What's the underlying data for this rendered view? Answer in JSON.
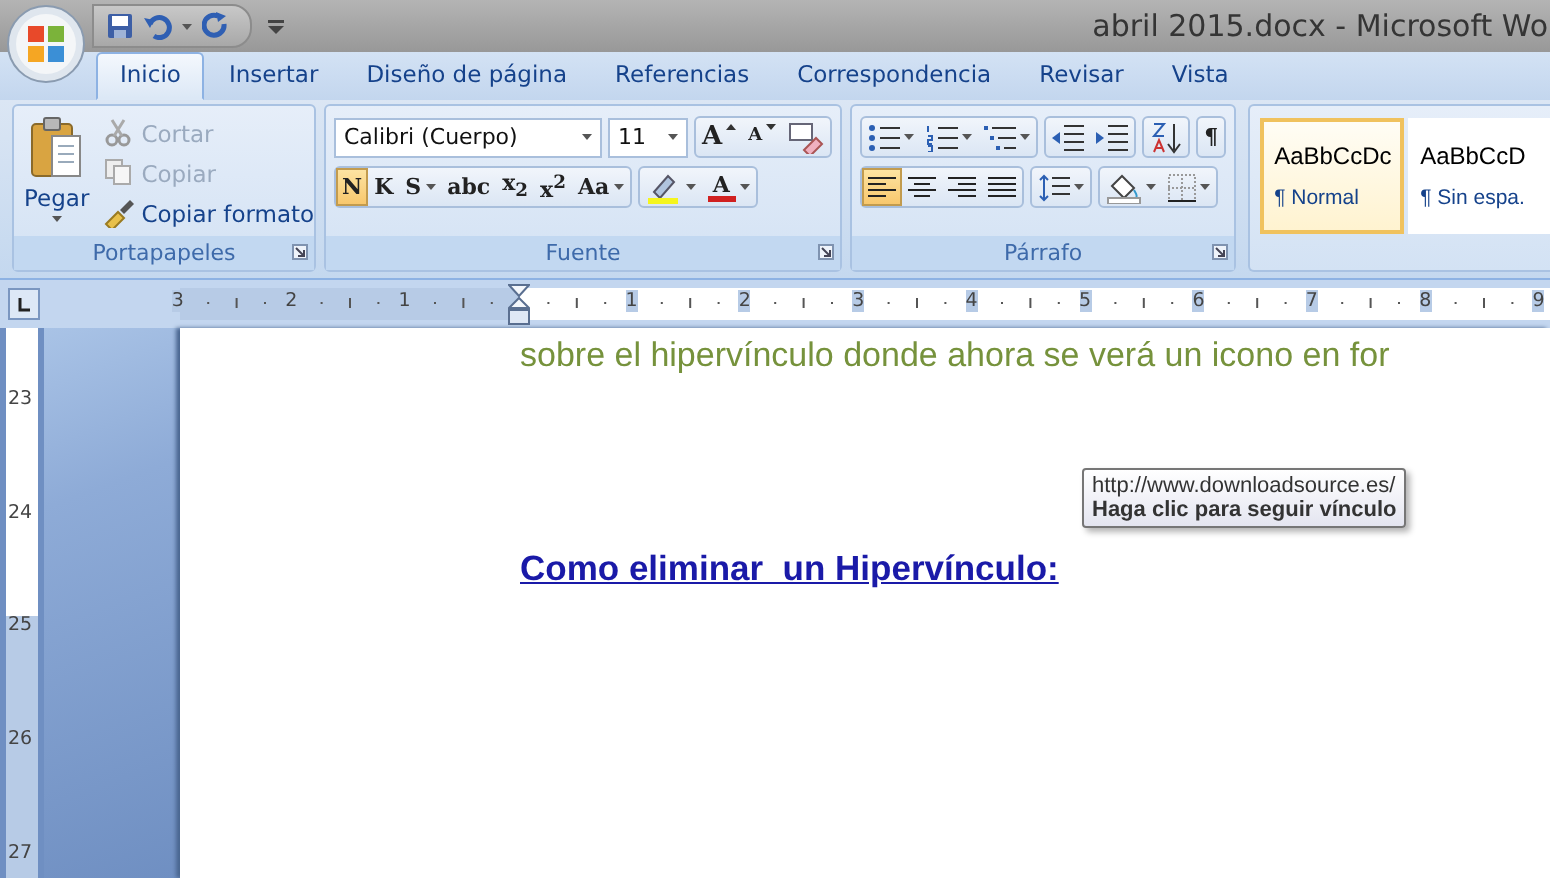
{
  "window": {
    "title": "abril 2015.docx - Microsoft Wo"
  },
  "tabs": [
    {
      "label": "Inicio",
      "selected": true
    },
    {
      "label": "Insertar",
      "selected": false
    },
    {
      "label": "Diseño de página",
      "selected": false
    },
    {
      "label": "Referencias",
      "selected": false
    },
    {
      "label": "Correspondencia",
      "selected": false
    },
    {
      "label": "Revisar",
      "selected": false
    },
    {
      "label": "Vista",
      "selected": false
    }
  ],
  "clipboard": {
    "label": "Portapapeles",
    "paste": "Pegar",
    "items": [
      {
        "kind": "cut",
        "label": "Cortar",
        "disabled": true
      },
      {
        "kind": "copy",
        "label": "Copiar",
        "disabled": true
      },
      {
        "kind": "brush",
        "label": "Copiar formato",
        "disabled": false
      }
    ]
  },
  "font": {
    "label": "Fuente",
    "font_name": "Calibri (Cuerpo)",
    "font_size": "11",
    "row1": [
      {
        "kind": "grow",
        "label": "A"
      },
      {
        "kind": "shrink",
        "label": "A"
      },
      {
        "kind": "eraser"
      }
    ],
    "row2": [
      {
        "kind": "glyph",
        "label": "N",
        "selected": true,
        "dropdown": false
      },
      {
        "kind": "glyph",
        "label": "K",
        "selected": false,
        "dropdown": false
      },
      {
        "kind": "glyph",
        "label": "S",
        "selected": false,
        "dropdown": true
      },
      {
        "kind": "glyph",
        "label": "abc",
        "selected": false,
        "dropdown": false
      },
      {
        "kind": "glyph",
        "label": "x$_{2}$",
        "selected": false,
        "dropdown": false
      },
      {
        "kind": "glyph",
        "label": "x$^{2}$",
        "selected": false,
        "dropdown": false
      },
      {
        "kind": "glyph",
        "label": "Aa",
        "selected": false,
        "dropdown": true
      },
      {
        "kind": "highlight",
        "selected": false,
        "dropdown": true
      },
      {
        "kind": "fontcolor",
        "label": "A",
        "selected": false,
        "dropdown": true
      }
    ]
  },
  "paragraph": {
    "label": "Párrafo",
    "row1": [
      {
        "kind": "bullets",
        "selected": false,
        "dropdown": true
      },
      {
        "kind": "numbers",
        "selected": false,
        "dropdown": true
      },
      {
        "kind": "multilevel",
        "selected": false,
        "dropdown": true
      },
      {
        "kind": "outdent",
        "selected": false,
        "dropdown": false
      },
      {
        "kind": "indent",
        "selected": false,
        "dropdown": false
      },
      {
        "kind": "sort",
        "selected": false,
        "dropdown": false
      },
      {
        "kind": "glyph",
        "label": "¶",
        "selected": false,
        "dropdown": false
      }
    ],
    "row2": [
      {
        "kind": "align-left",
        "selected": true,
        "dropdown": false
      },
      {
        "kind": "align-center",
        "selected": false,
        "dropdown": false
      },
      {
        "kind": "align-right",
        "selected": false,
        "dropdown": false
      },
      {
        "kind": "justify",
        "selected": false,
        "dropdown": false
      },
      {
        "kind": "spacing",
        "selected": false,
        "dropdown": true
      },
      {
        "kind": "shading",
        "selected": false,
        "dropdown": true
      },
      {
        "kind": "borders",
        "selected": false,
        "dropdown": true
      }
    ]
  },
  "styles": [
    {
      "preview": "AaBbCcDc",
      "label": "¶ Normal",
      "selected": true
    },
    {
      "preview": "AaBbCcD",
      "label": "¶ Sin espa.",
      "selected": false
    }
  ],
  "ruler": {
    "numbers": [
      "3",
      "2",
      "1",
      "1",
      "2",
      "3",
      "4",
      "5",
      "6",
      "7",
      "8",
      "9"
    ],
    "vertical_numbers": [
      "23",
      "24",
      "25",
      "26",
      "27"
    ]
  },
  "document": {
    "paragraph": "sobre el hipervínculo donde ahora se verá un icono en for",
    "heading_link": "Como eliminar  un Hipervínculo:",
    "tooltip": {
      "url": "http://www.downloadsource.es/",
      "hint": "Haga clic para seguir vínculo"
    }
  }
}
